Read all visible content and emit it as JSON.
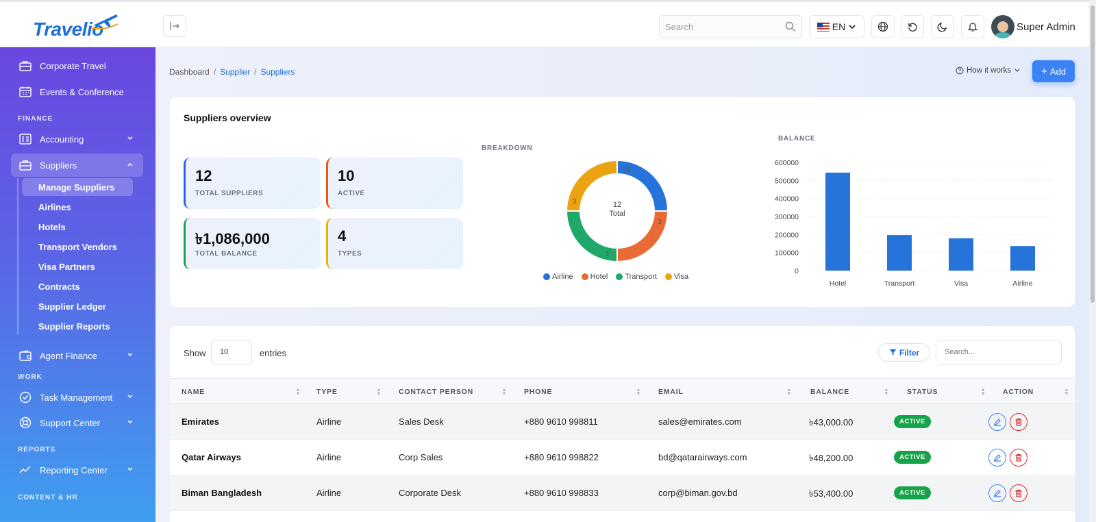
{
  "brand": {
    "name": "Travelio"
  },
  "topbar": {
    "search_placeholder": "Search",
    "language": "EN",
    "user_name": "Super Admin"
  },
  "sidebar": {
    "items": [
      {
        "label": "Corporate Travel"
      },
      {
        "label": "Events & Conference"
      }
    ],
    "sections": {
      "finance": "FINANCE",
      "work": "WORK",
      "reports": "REPORTS",
      "content_hr": "CONTENT & HR"
    },
    "finance_items": [
      {
        "label": "Accounting"
      },
      {
        "label": "Suppliers"
      }
    ],
    "supplier_subitems": [
      {
        "label": "Manage Suppliers"
      },
      {
        "label": "Airlines"
      },
      {
        "label": "Hotels"
      },
      {
        "label": "Transport Vendors"
      },
      {
        "label": "Visa Partners"
      },
      {
        "label": "Contracts"
      },
      {
        "label": "Supplier Ledger"
      },
      {
        "label": "Supplier Reports"
      }
    ],
    "agent_finance": "Agent Finance",
    "work_items": [
      {
        "label": "Task Management"
      },
      {
        "label": "Support Center"
      }
    ],
    "reports_items": [
      {
        "label": "Reporting Center"
      }
    ]
  },
  "breadcrumb": {
    "home": "Dashboard",
    "parent": "Supplier",
    "current": "Suppliers",
    "sep": "/"
  },
  "header_actions": {
    "how_it_works": "How it works",
    "add": "Add"
  },
  "overview": {
    "title": "Suppliers overview",
    "stats": [
      {
        "value": "12",
        "label": "TOTAL SUPPLIERS",
        "color": "#2563eb"
      },
      {
        "value": "10",
        "label": "ACTIVE",
        "color": "#ea580c"
      },
      {
        "value": "৳1,086,000",
        "label": "TOTAL BALANCE",
        "color": "#16a34a"
      },
      {
        "value": "4",
        "label": "TYPES",
        "color": "#eab308"
      }
    ],
    "breakdown_label": "BREAKDOWN",
    "balance_label": "BALANCE",
    "donut_center_value": "12",
    "donut_center_label": "Total"
  },
  "chart_data": [
    {
      "type": "pie",
      "title": "BREAKDOWN",
      "categories": [
        "Airline",
        "Hotel",
        "Transport",
        "Visa"
      ],
      "values": [
        3,
        3,
        3,
        3
      ],
      "colors": [
        "#2673d9",
        "#ea6a35",
        "#20a86b",
        "#eba312"
      ],
      "legend": "bottom"
    },
    {
      "type": "bar",
      "title": "BALANCE",
      "categories": [
        "Hotel",
        "Transport",
        "Visa",
        "Airline"
      ],
      "values": [
        543000,
        197000,
        179000,
        136000
      ],
      "ylim": [
        0,
        600000
      ],
      "yticks": [
        "600000",
        "500000",
        "400000",
        "300000",
        "200000",
        "100000",
        "0"
      ],
      "color": "#2673d9",
      "grid": true
    }
  ],
  "table": {
    "show_label": "Show",
    "page_size": "10",
    "entries_label": "entries",
    "filter_label": "Filter",
    "search_placeholder": "Search...",
    "columns": [
      "NAME",
      "TYPE",
      "CONTACT PERSON",
      "PHONE",
      "EMAIL",
      "BALANCE",
      "STATUS",
      "ACTION"
    ],
    "rows": [
      {
        "name": "Emirates",
        "type": "Airline",
        "contact": "Sales Desk",
        "phone": "+880 9610 998811",
        "email": "sales@emirates.com",
        "balance": "৳43,000.00",
        "status": "ACTIVE"
      },
      {
        "name": "Qatar Airways",
        "type": "Airline",
        "contact": "Corp Sales",
        "phone": "+880 9610 998822",
        "email": "bd@qatarairways.com",
        "balance": "৳48,200.00",
        "status": "ACTIVE"
      },
      {
        "name": "Biman Bangladesh",
        "type": "Airline",
        "contact": "Corporate Desk",
        "phone": "+880 9610 998833",
        "email": "corp@biman.gov.bd",
        "balance": "৳53,400.00",
        "status": "ACTIVE"
      }
    ]
  }
}
